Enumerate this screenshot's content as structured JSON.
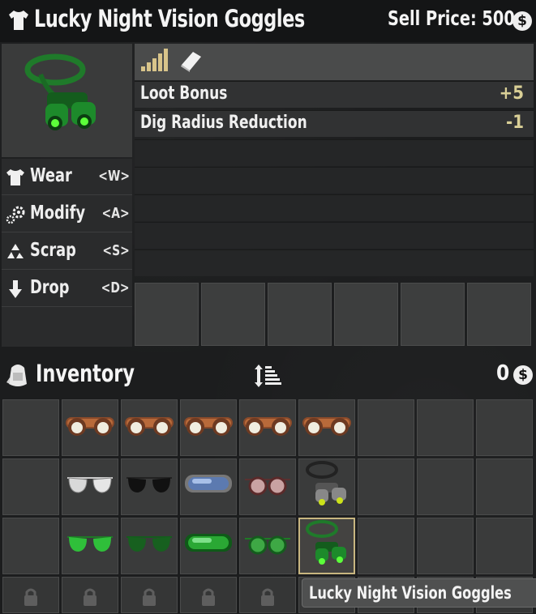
{
  "item": {
    "name": "Lucky Night Vision Goggles",
    "sell_price_label": "Sell Price: 500",
    "currency_symbol": "$"
  },
  "actions": [
    {
      "label": "Wear",
      "key": "<W>",
      "icon": "shirt-icon"
    },
    {
      "label": "Modify",
      "key": "<A>",
      "icon": "gears-icon"
    },
    {
      "label": "Scrap",
      "key": "<S>",
      "icon": "recycle-icon"
    },
    {
      "label": "Drop",
      "key": "<D>",
      "icon": "down-arrow-icon"
    }
  ],
  "stats": [
    {
      "name": "Loot Bonus",
      "value": "+5"
    },
    {
      "name": "Dig Radius Reduction",
      "value": "-1"
    }
  ],
  "quality_tier": 5,
  "inventory": {
    "title": "Inventory",
    "money": "0",
    "currency_symbol": "$",
    "rows": [
      [
        "",
        "steampunk-goggles",
        "steampunk-goggles",
        "steampunk-goggles",
        "steampunk-goggles",
        "steampunk-goggles",
        "",
        "",
        ""
      ],
      [
        "",
        "aviator-glasses-silver",
        "aviator-glasses-black",
        "ski-goggles-blue",
        "round-glasses-pink",
        "night-vision-goggles",
        "",
        "",
        ""
      ],
      [
        "",
        "aviator-glasses-green",
        "aviator-glasses-green-dark",
        "ski-goggles-green",
        "round-glasses-green",
        "night-vision-goggles-green",
        "",
        "",
        ""
      ]
    ]
  },
  "tooltip": "Lucky Night Vision Goggles",
  "colors": {
    "accent": "#c8b680",
    "stat_value": "#d9cf96",
    "panel": "#3a3b3b"
  }
}
